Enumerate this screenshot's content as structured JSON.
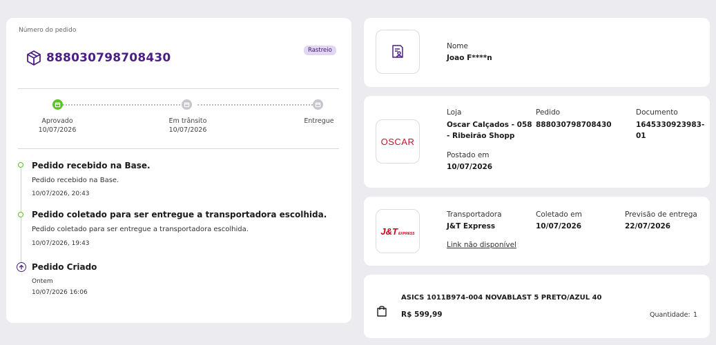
{
  "order": {
    "label": "Número do pedido",
    "number": "888030798708430",
    "badge": "Rastreio"
  },
  "steps": [
    {
      "label": "Aprovado",
      "date": "10/07/2026",
      "state": "done"
    },
    {
      "label": "Em trânsito",
      "date": "10/07/2026",
      "state": "pending"
    },
    {
      "label": "Entregue",
      "date": "",
      "state": "pending"
    }
  ],
  "timeline": [
    {
      "title": "Pedido recebido na Base.",
      "description": "Pedido recebido na Base.",
      "time": "10/07/2026, 20:43"
    },
    {
      "title": "Pedido coletado para ser entregue a transportadora escolhida.",
      "description": "Pedido coletado para ser entregue a transportadora escolhida.",
      "time": "10/07/2026, 19:43"
    },
    {
      "title": "Pedido Criado",
      "description": "Ontem",
      "time": "10/07/2026 16:06"
    }
  ],
  "customer": {
    "name_label": "Nome",
    "name_value": "Joao F****n",
    "icon": "document-user-icon"
  },
  "store": {
    "logo_text": "OSCAR",
    "store_label": "Loja",
    "store_value_line1": "Oscar Calçados - 058",
    "store_value_line2": "- Ribeirão Shopp",
    "order_label": "Pedido",
    "order_value": "888030798708430",
    "document_label": "Documento",
    "document_value_line1": "1645330923983-",
    "document_value_line2": "01",
    "posted_label": "Postado em",
    "posted_value": "10/07/2026"
  },
  "carrier": {
    "logo_text": "J&T",
    "logo_subtext": "EXPRESS",
    "carrier_label": "Transportadora",
    "carrier_value": "J&T Express",
    "collected_label": "Coletado em",
    "collected_value": "10/07/2026",
    "forecast_label": "Previsão de entrega",
    "forecast_value": "22/07/2026",
    "link_text": "Link não disponível"
  },
  "product": {
    "name": "ASICS 1011B974-004 NOVABLAST 5 PRETO/AZUL 40",
    "price": "R$ 599,99",
    "quantity_label": "Quantidade:",
    "quantity_value": "1",
    "icon": "shopping-bag-icon"
  },
  "colors": {
    "accent": "#4b1d86",
    "success": "#58c322",
    "badge_bg": "#e2d6f3",
    "oscar_red": "#c8102e",
    "jt_red": "#d0021b"
  }
}
